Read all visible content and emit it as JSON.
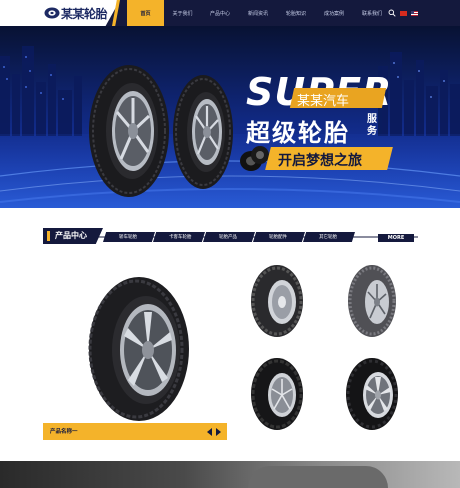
{
  "header": {
    "logo_text": "某某轮胎",
    "nav": [
      "首页",
      "关于我们",
      "产品中心",
      "新闻资讯",
      "轮胎知识",
      "成功案例",
      "联系我们"
    ],
    "active_nav_index": 0,
    "icons": [
      "search-icon",
      "flag-cn-icon",
      "flag-en-icon"
    ]
  },
  "banner": {
    "super_word": "SUPER",
    "tag_text": "某某汽车",
    "main_title": "超级轮胎",
    "service_word": "服务",
    "slogan": "开启梦想之旅",
    "slide_count": 3,
    "active_slide": 1
  },
  "products": {
    "section_title": "产品中心",
    "categories": [
      "轿车轮胎",
      "卡客车轮胎",
      "轮胎产品",
      "轮胎配件",
      "其它轮胎"
    ],
    "more_label": "MORE",
    "featured_caption": "产品名称一"
  },
  "colors": {
    "navy": "#14193d",
    "accent": "#f4b32a",
    "banner_blue": "#11268a"
  }
}
